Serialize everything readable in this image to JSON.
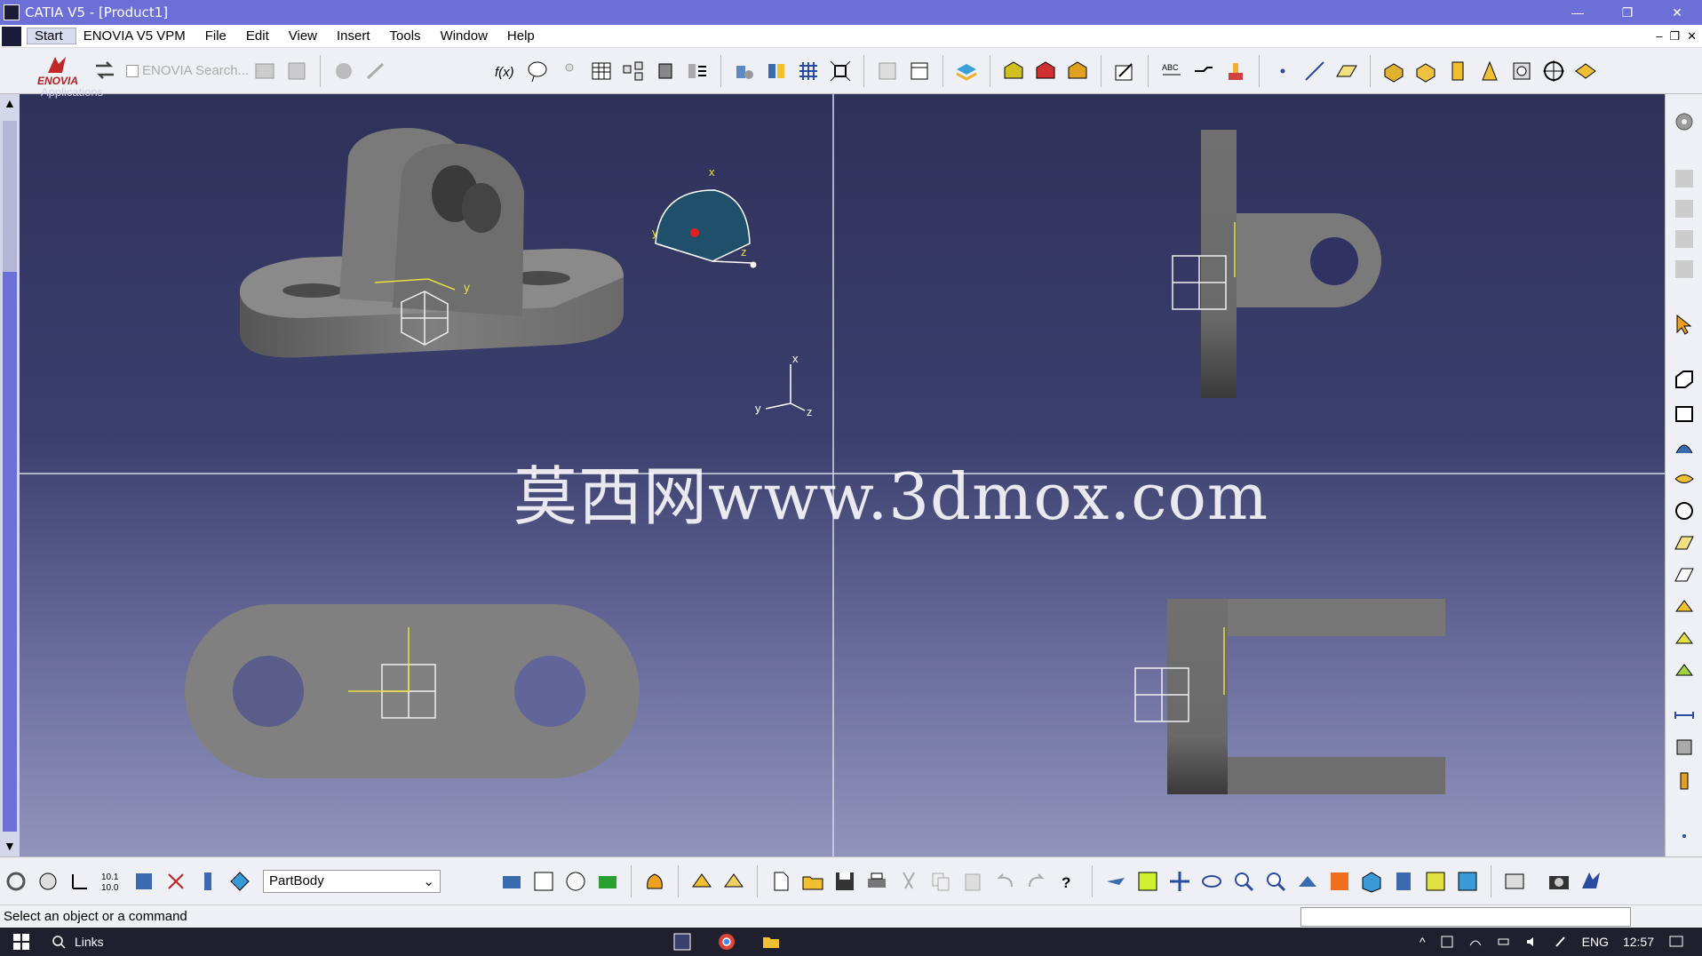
{
  "window": {
    "title": "CATIA V5 - [Product1]",
    "controls": {
      "minimize": "—",
      "restore": "❐",
      "close": "✕"
    }
  },
  "menu": {
    "items": [
      "Start",
      "ENOVIA V5 VPM",
      "File",
      "Edit",
      "View",
      "Insert",
      "Tools",
      "Window",
      "Help"
    ],
    "doc_controls": {
      "minimize": "–",
      "restore": "❐",
      "close": "✕"
    }
  },
  "toolbar_top": {
    "enovia_logo_text": "ENOVIA",
    "enovia_search_label": "ENOVIA Search..."
  },
  "viewport": {
    "applications_label": "Applications",
    "watermark": "莫西网www.3dmox.com",
    "compass_x": "x",
    "compass_y": "y",
    "compass_z": "z",
    "axis_x": "x",
    "axis_y": "y",
    "axis_z": "z"
  },
  "toolbar_bottom": {
    "body_select": "PartBody"
  },
  "status": {
    "message": "Select an object or a command"
  },
  "taskbar": {
    "search_label": "Links",
    "language": "ENG",
    "time": "12:57"
  },
  "colors": {
    "titlebar": "#6b6fd6",
    "viewport_top": "#2e3159",
    "viewport_bottom": "#9194bc",
    "part_gray": "#7a7a7a"
  }
}
